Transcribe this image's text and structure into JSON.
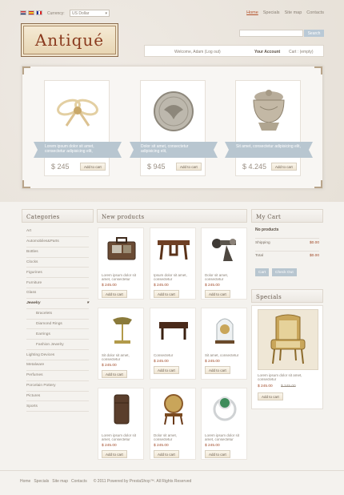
{
  "topbar": {
    "currency_label": "Currency:",
    "currency_value": "US Dollar",
    "nav": [
      "Home",
      "Specials",
      "Site map",
      "Contacts"
    ]
  },
  "logo": {
    "text": "Antiqué"
  },
  "search": {
    "button_label": "Search",
    "placeholder": ""
  },
  "userbar": {
    "welcome": "Welcome, Adam (Log out)",
    "account": "Your Account",
    "cart": "Cart : (empty)"
  },
  "slider": {
    "items": [
      {
        "text": "Lorem ipsum dolor sit amet, consectetur adipisicing elit,",
        "price": "$ 245",
        "button": "Add to cart",
        "icon": "bow-ornament"
      },
      {
        "text": "Dolor sit amet, consectetur adipisicing elit,",
        "price": "$ 945",
        "button": "Add to cart",
        "icon": "coin"
      },
      {
        "text": "Sit amet, consectetur adipisicing elit,",
        "price": "$ 4.245",
        "button": "Add to cart",
        "icon": "jewelry-box"
      }
    ]
  },
  "categories": {
    "title": "Categories",
    "items": [
      {
        "label": "Art"
      },
      {
        "label": "Automobiles&Parts"
      },
      {
        "label": "Bottles"
      },
      {
        "label": "Clocks"
      },
      {
        "label": "Figurines"
      },
      {
        "label": "Furniture"
      },
      {
        "label": "Glass"
      },
      {
        "label": "Jewelry",
        "active": true
      },
      {
        "label": "Bracelets",
        "sub": true
      },
      {
        "label": "Diamond Rings",
        "sub": true
      },
      {
        "label": "Earrings",
        "sub": true
      },
      {
        "label": "Fashion Jewelry",
        "sub": true
      },
      {
        "label": "Lighting Devices"
      },
      {
        "label": "Metalware"
      },
      {
        "label": "Perfumes"
      },
      {
        "label": "Porcelain Pottery"
      },
      {
        "label": "Pictures"
      },
      {
        "label": "Sports"
      }
    ]
  },
  "new_products": {
    "title": "New products",
    "items": [
      {
        "name": "Lorem ipsum dolor sit amet, consectetur",
        "price": "$ 245.00",
        "button": "Add to cart",
        "icon": "suitcase"
      },
      {
        "name": "Ipsum dolor sit amet, consectetur",
        "price": "$ 245.00",
        "button": "Add to cart",
        "icon": "table"
      },
      {
        "name": "Dolor sit amet, consectetur",
        "price": "$ 245.00",
        "button": "Add to cart",
        "icon": "machine"
      },
      {
        "name": "Sit dolor sit amet, consectetur",
        "price": "$ 245.00",
        "button": "Add to cart",
        "icon": "desk-lamp"
      },
      {
        "name": "Consectetur",
        "price": "$ 245.00",
        "button": "Add to cart",
        "icon": "low-table"
      },
      {
        "name": "Sit amet, consectetur",
        "price": "$ 245.00",
        "button": "Add to cart",
        "icon": "clock-dome"
      },
      {
        "name": "Lorem ipsum dolor sit amet, consectetur",
        "price": "$ 245.00",
        "button": "Add to cart",
        "icon": "lighter"
      },
      {
        "name": "Dolor sit amet, consectetur",
        "price": "$ 245.00",
        "button": "Add to cart",
        "icon": "globe"
      },
      {
        "name": "Lorem ipsum dolor sit amet, consectetur",
        "price": "$ 245.00",
        "button": "Add to cart",
        "icon": "ring"
      }
    ]
  },
  "my_cart": {
    "title": "My Cart",
    "empty": "No products",
    "shipping_label": "Shipping",
    "shipping_value": "$0.00",
    "total_label": "Total",
    "total_value": "$0.00",
    "cart_button": "Cart",
    "checkout_button": "Check Out"
  },
  "specials": {
    "title": "Specials",
    "name": "Lorem ipsum dolor sit amet, consectetur",
    "price": "$ 245.00",
    "old_price": "$ 245.00",
    "button": "Add to cart",
    "icon": "armchair"
  },
  "footer": {
    "links": [
      "Home",
      "Specials",
      "Site map",
      "Contacts"
    ],
    "copyright": "© 2011 Powered by PrestaShop™. All Rights Reserved"
  },
  "colors": {
    "accent": "#b4532c",
    "ribbon": "#b8c6d0",
    "price": "#a04a28"
  }
}
